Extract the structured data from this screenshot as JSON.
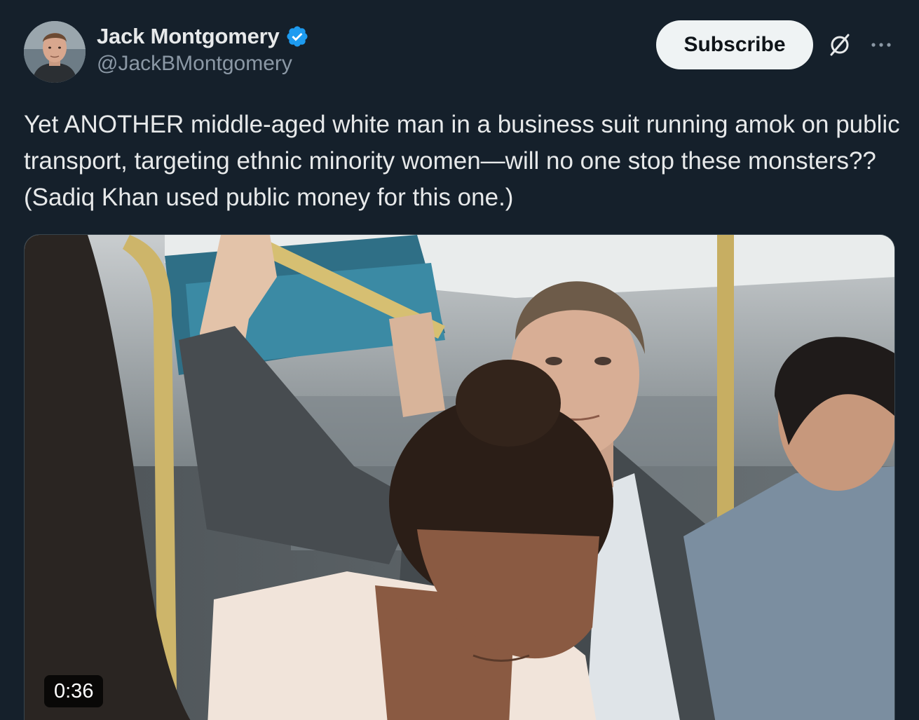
{
  "author": {
    "name": "Jack Montgomery",
    "handle": "@JackBMontgomery",
    "verified": true,
    "verified_color": "#1d9bf0"
  },
  "actions": {
    "subscribe_label": "Subscribe",
    "grok_icon": "grok-icon",
    "more_icon": "more-icon"
  },
  "post": {
    "text": "Yet ANOTHER middle-aged white man in a business suit running amok on public transport, targeting ethnic minority women—will no one stop these monsters?? (Sadiq Khan used public money for this one.)"
  },
  "media": {
    "type": "video",
    "duration": "0:36"
  },
  "colors": {
    "background": "#15202b",
    "text": "#e7e9ea",
    "secondary_text": "#8b98a5",
    "button_bg": "#eff3f4"
  }
}
